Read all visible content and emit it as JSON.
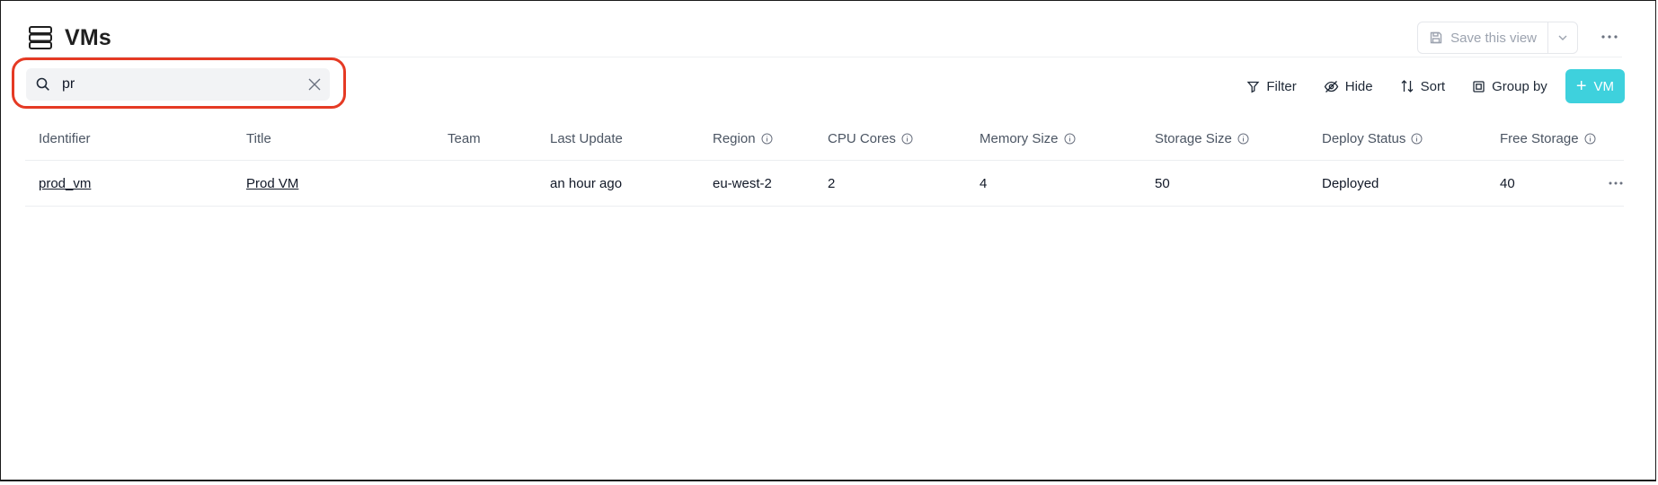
{
  "page": {
    "title": "VMs",
    "title_icon": "database-icon"
  },
  "header_actions": {
    "save_label": "Save this view",
    "save_icon": "save-icon",
    "dropdown_icon": "chevron-down-icon",
    "more_icon": "more-horizontal-icon"
  },
  "search": {
    "value": "pr",
    "icon": "search-icon",
    "clear_icon": "close-icon"
  },
  "toolbar": {
    "filter_label": "Filter",
    "hide_label": "Hide",
    "sort_label": "Sort",
    "group_label": "Group by",
    "add_label": "VM",
    "add_plus": "+"
  },
  "colors": {
    "accent": "#3ed1dd",
    "highlight": "#e53a24"
  },
  "table": {
    "columns": [
      {
        "label": "Identifier",
        "info": false
      },
      {
        "label": "Title",
        "info": false
      },
      {
        "label": "Team",
        "info": false
      },
      {
        "label": "Last Update",
        "info": false
      },
      {
        "label": "Region",
        "info": true
      },
      {
        "label": "CPU Cores",
        "info": true
      },
      {
        "label": "Memory Size",
        "info": true
      },
      {
        "label": "Storage Size",
        "info": true
      },
      {
        "label": "Deploy Status",
        "info": true
      },
      {
        "label": "Free Storage",
        "info": true
      }
    ],
    "rows": [
      {
        "identifier": "prod_vm",
        "title": "Prod VM",
        "team": "",
        "last_update": "an hour ago",
        "region": "eu-west-2",
        "cpu_cores": "2",
        "memory_size": "4",
        "storage_size": "50",
        "deploy_status": "Deployed",
        "free_storage": "40"
      }
    ]
  }
}
